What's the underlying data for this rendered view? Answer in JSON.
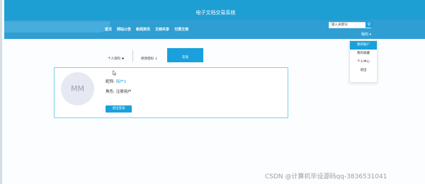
{
  "site": {
    "title": "电子文档交易系统"
  },
  "nav": {
    "items": [
      "首页",
      "网站公告",
      "新闻资讯",
      "文档共享",
      "付费文档"
    ]
  },
  "search": {
    "placeholder": "输入关键词"
  },
  "user_menu": {
    "label": "我的",
    "dropdown": [
      "我的账户",
      "我的收藏",
      "个人中心",
      "退出"
    ]
  },
  "tabs": {
    "profile": "个人资料",
    "password": "修改密码",
    "active": "充值"
  },
  "profile": {
    "avatar_text": "MM",
    "nickname_label": "昵称:",
    "nickname_value": "用户1",
    "role_label": "角色:",
    "role_value": "注册用户",
    "logout_label": "退出登录"
  },
  "watermark": "CSDN @计算机毕设源码qq-3836531041"
}
